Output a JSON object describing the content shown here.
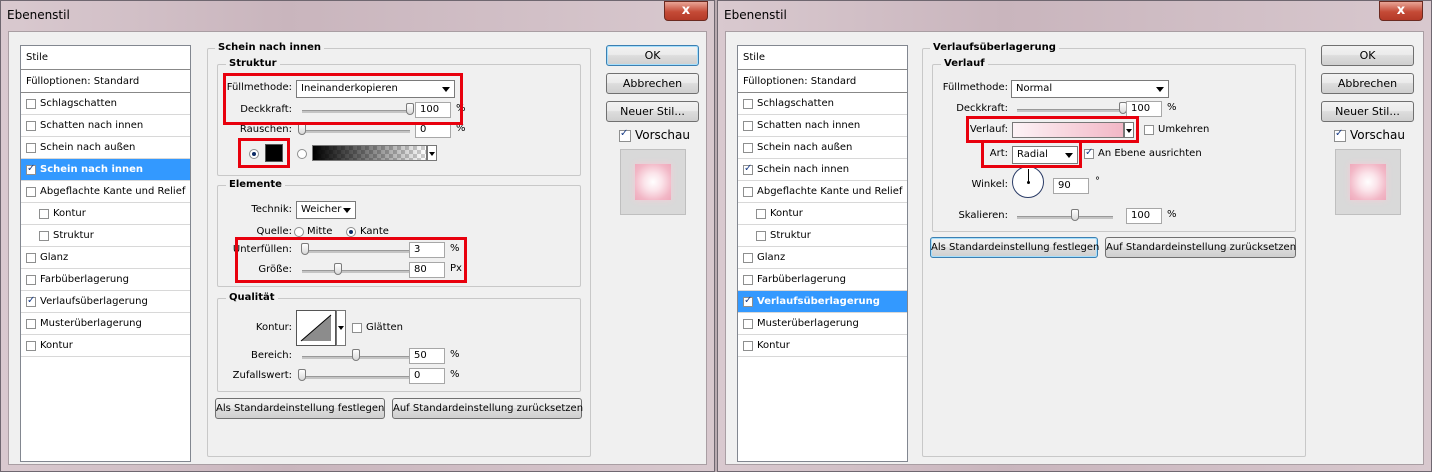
{
  "left": {
    "title": "Ebenenstil",
    "close": "x",
    "styles": {
      "header": "Stile",
      "blend_options": "Fülloptionen: Standard",
      "items": [
        {
          "label": "Schlagschatten",
          "checked": false
        },
        {
          "label": "Schatten nach innen",
          "checked": false
        },
        {
          "label": "Schein nach außen",
          "checked": false
        },
        {
          "label": "Schein nach innen",
          "checked": true,
          "selected": true
        },
        {
          "label": "Abgeflachte Kante und Relief",
          "checked": false
        },
        {
          "label": "Kontur",
          "checked": false,
          "indent": true
        },
        {
          "label": "Struktur",
          "checked": false,
          "indent": true
        },
        {
          "label": "Glanz",
          "checked": false
        },
        {
          "label": "Farbüberlagerung",
          "checked": false
        },
        {
          "label": "Verlaufsüberlagerung",
          "checked": true
        },
        {
          "label": "Musterüberlagerung",
          "checked": false
        },
        {
          "label": "Kontur",
          "checked": false
        }
      ]
    },
    "section_title": "Schein nach innen",
    "struktur": {
      "title": "Struktur",
      "blend_label": "Füllmethode:",
      "blend_value": "Ineinanderkopieren",
      "opacity_label": "Deckkraft:",
      "opacity_value": "100",
      "opacity_pct": 100,
      "noise_label": "Rauschen:",
      "noise_value": "0",
      "noise_pct": 0,
      "unit": "%"
    },
    "elemente": {
      "title": "Elemente",
      "technique_label": "Technik:",
      "technique_value": "Weicher",
      "source_label": "Quelle:",
      "source_center": "Mitte",
      "source_edge": "Kante",
      "choke_label": "Unterfüllen:",
      "choke_value": "3",
      "choke_pct": 3,
      "size_label": "Größe:",
      "size_value": "80",
      "size_unit": "Px",
      "unit": "%"
    },
    "qualitaet": {
      "title": "Qualität",
      "contour_label": "Kontur:",
      "smooth_label": "Glätten",
      "range_label": "Bereich:",
      "range_value": "50",
      "range_pct": 50,
      "jitter_label": "Zufallswert:",
      "jitter_value": "0",
      "jitter_pct": 0,
      "unit": "%"
    },
    "btn_make_default": "Als Standardeinstellung festlegen",
    "btn_reset_default": "Auf Standardeinstellung zurücksetzen",
    "ok": "OK",
    "cancel": "Abbrechen",
    "new_style": "Neuer Stil...",
    "preview_label": "Vorschau"
  },
  "right": {
    "title": "Ebenenstil",
    "close": "x",
    "styles": {
      "header": "Stile",
      "blend_options": "Fülloptionen: Standard",
      "items": [
        {
          "label": "Schlagschatten",
          "checked": false
        },
        {
          "label": "Schatten nach innen",
          "checked": false
        },
        {
          "label": "Schein nach außen",
          "checked": false
        },
        {
          "label": "Schein nach innen",
          "checked": true
        },
        {
          "label": "Abgeflachte Kante und Relief",
          "checked": false
        },
        {
          "label": "Kontur",
          "checked": false,
          "indent": true
        },
        {
          "label": "Struktur",
          "checked": false,
          "indent": true
        },
        {
          "label": "Glanz",
          "checked": false
        },
        {
          "label": "Farbüberlagerung",
          "checked": false
        },
        {
          "label": "Verlaufsüberlagerung",
          "checked": true,
          "selected": true
        },
        {
          "label": "Musterüberlagerung",
          "checked": false
        },
        {
          "label": "Kontur",
          "checked": false
        }
      ]
    },
    "section_title": "Verlaufsüberlagerung",
    "verlauf": {
      "title": "Verlauf",
      "blend_label": "Füllmethode:",
      "blend_value": "Normal",
      "opacity_label": "Deckkraft:",
      "opacity_value": "100",
      "opacity_pct": 100,
      "gradient_label": "Verlauf:",
      "reverse_label": "Umkehren",
      "style_label": "Art:",
      "style_value": "Radial",
      "align_label": "An Ebene ausrichten",
      "angle_label": "Winkel:",
      "angle_value": "90",
      "angle_unit": "°",
      "scale_label": "Skalieren:",
      "scale_value": "100",
      "scale_pct": 60,
      "unit": "%"
    },
    "btn_make_default": "Als Standardeinstellung festlegen",
    "btn_reset_default": "Auf Standardeinstellung zurücksetzen",
    "ok": "OK",
    "cancel": "Abbrechen",
    "new_style": "Neuer Stil...",
    "preview_label": "Vorschau"
  },
  "colors": {
    "highlight": "#3399ff",
    "annotation_red": "#e8000d",
    "gradient_pink": "#f2b7c6"
  }
}
